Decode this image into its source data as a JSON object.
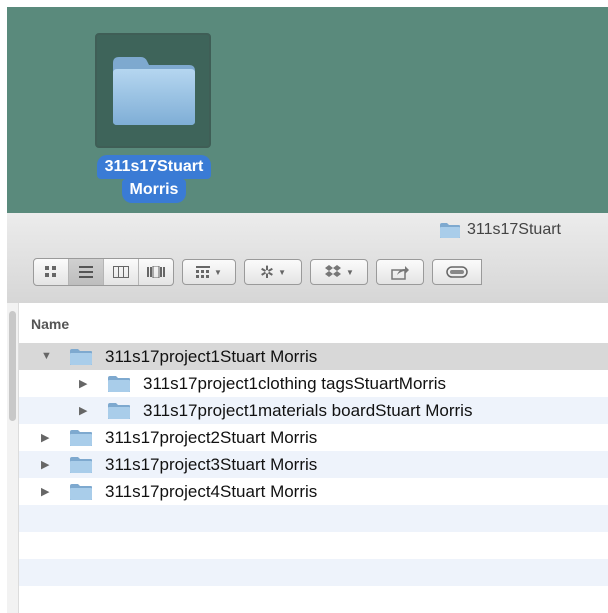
{
  "desktop": {
    "icon_label_line1": "311s17Stuart",
    "icon_label_line2": "Morris",
    "icon": "folder-icon"
  },
  "window": {
    "title": "311s17Stuart",
    "toolbar": {
      "view_buttons": [
        "icon-view",
        "list-view",
        "column-view",
        "cover-flow-view"
      ],
      "selected_view": "list-view",
      "arrange_icon": "arrange-icon",
      "action_icon": "gear-icon",
      "dropbox_icon": "dropbox-icon",
      "share_icon": "share-icon",
      "tags_icon": "tag-icon"
    }
  },
  "list": {
    "column_header": "Name",
    "rows": [
      {
        "label": "311s17project1Stuart Morris",
        "level": 0,
        "expanded": true,
        "selected": true
      },
      {
        "label": "311s17project1clothing tagsStuartMorris",
        "level": 1,
        "expanded": false,
        "selected": false
      },
      {
        "label": "311s17project1materials boardStuart Morris",
        "level": 1,
        "expanded": false,
        "selected": false
      },
      {
        "label": "311s17project2Stuart Morris",
        "level": 0,
        "expanded": false,
        "selected": false
      },
      {
        "label": "311s17project3Stuart Morris",
        "level": 0,
        "expanded": false,
        "selected": false
      },
      {
        "label": "311s17project4Stuart Morris",
        "level": 0,
        "expanded": false,
        "selected": false
      }
    ],
    "colors": {
      "row_alt": "#eef3fb",
      "row_selected": "#d8d8d8",
      "folder": "#8cb9e0"
    }
  }
}
